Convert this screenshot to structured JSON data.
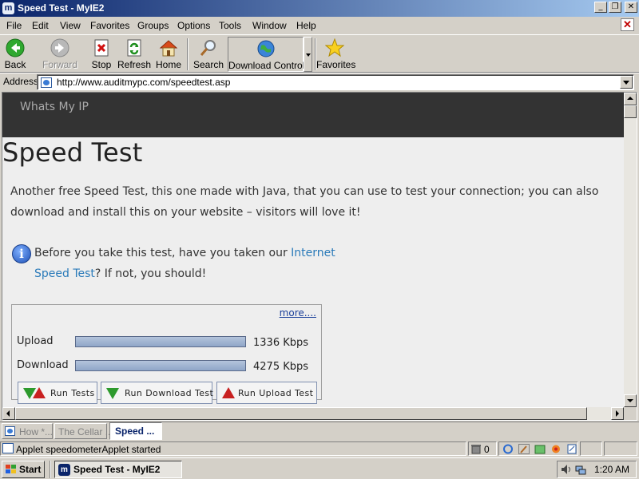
{
  "window": {
    "title": "Speed Test - MyIE2",
    "app_icon_letter": "m",
    "controls": {
      "minimize": "_",
      "restore": "❐",
      "close": "✕"
    }
  },
  "menu": {
    "items": [
      {
        "label": "File"
      },
      {
        "label": "Edit"
      },
      {
        "label": "View"
      },
      {
        "label": "Favorites"
      },
      {
        "label": "Groups"
      },
      {
        "label": "Options"
      },
      {
        "label": "Tools"
      },
      {
        "label": "Window"
      },
      {
        "label": "Help"
      }
    ],
    "close_glyph": "✕"
  },
  "toolbar": {
    "back": "Back",
    "forward": "Forward",
    "stop": "Stop",
    "refresh": "Refresh",
    "home": "Home",
    "search": "Search",
    "download_control": "Download Control",
    "favorites": "Favorites"
  },
  "address": {
    "label": "Address",
    "value": "http://www.auditmypc.com/speedtest.asp"
  },
  "page": {
    "site_name": "Whats My IP",
    "title": "Speed Test",
    "intro": "Another free Speed Test, this one made with Java, that you can use to test your connection; you can also download and install this on your website – visitors will love it!",
    "info_icon_glyph": "i",
    "info_before": "Before you take this test, have you taken our ",
    "info_link": "Internet Speed Test",
    "info_after": "? If not, you should!",
    "speed_panel": {
      "more_link": "more....",
      "upload_label": "Upload",
      "upload_value": "1336 Kbps",
      "download_label": "Download",
      "download_value": "4275 Kbps",
      "upload_bar_fill": 1.0,
      "download_bar_fill": 1.0,
      "buttons": {
        "run_tests": "Run Tests",
        "run_download": "Run Download Test",
        "run_upload": "Run Upload Test"
      }
    }
  },
  "tabs": [
    {
      "label": "How *...",
      "active": false
    },
    {
      "label": "The Cellar ...",
      "active": false
    },
    {
      "label": "Speed ...",
      "active": true
    }
  ],
  "status": {
    "text": "Applet speedometerApplet started",
    "trash_count": "0"
  },
  "taskbar": {
    "start": "Start",
    "task": "Speed Test - MyIE2",
    "clock": "1:20 AM"
  },
  "colors": {
    "title_gradient_start": "#0a246a",
    "link": "#2a7ab9",
    "site_header": "#333333",
    "bar_fill": "#8fa6c8",
    "green_arrow": "#2d9a2d",
    "red_arrow": "#c82020"
  }
}
